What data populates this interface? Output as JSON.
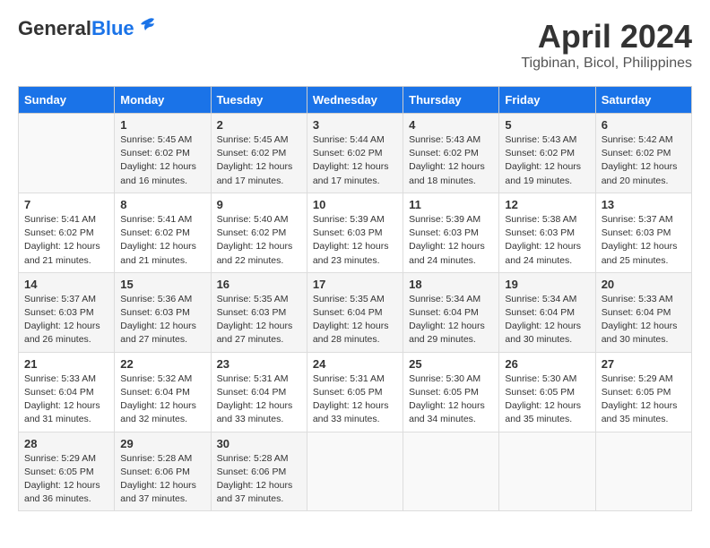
{
  "header": {
    "logo_general": "General",
    "logo_blue": "Blue",
    "month": "April 2024",
    "location": "Tigbinan, Bicol, Philippines"
  },
  "calendar": {
    "days_of_week": [
      "Sunday",
      "Monday",
      "Tuesday",
      "Wednesday",
      "Thursday",
      "Friday",
      "Saturday"
    ],
    "weeks": [
      [
        {
          "day": "",
          "info": ""
        },
        {
          "day": "1",
          "info": "Sunrise: 5:45 AM\nSunset: 6:02 PM\nDaylight: 12 hours\nand 16 minutes."
        },
        {
          "day": "2",
          "info": "Sunrise: 5:45 AM\nSunset: 6:02 PM\nDaylight: 12 hours\nand 17 minutes."
        },
        {
          "day": "3",
          "info": "Sunrise: 5:44 AM\nSunset: 6:02 PM\nDaylight: 12 hours\nand 17 minutes."
        },
        {
          "day": "4",
          "info": "Sunrise: 5:43 AM\nSunset: 6:02 PM\nDaylight: 12 hours\nand 18 minutes."
        },
        {
          "day": "5",
          "info": "Sunrise: 5:43 AM\nSunset: 6:02 PM\nDaylight: 12 hours\nand 19 minutes."
        },
        {
          "day": "6",
          "info": "Sunrise: 5:42 AM\nSunset: 6:02 PM\nDaylight: 12 hours\nand 20 minutes."
        }
      ],
      [
        {
          "day": "7",
          "info": "Sunrise: 5:41 AM\nSunset: 6:02 PM\nDaylight: 12 hours\nand 21 minutes."
        },
        {
          "day": "8",
          "info": "Sunrise: 5:41 AM\nSunset: 6:02 PM\nDaylight: 12 hours\nand 21 minutes."
        },
        {
          "day": "9",
          "info": "Sunrise: 5:40 AM\nSunset: 6:02 PM\nDaylight: 12 hours\nand 22 minutes."
        },
        {
          "day": "10",
          "info": "Sunrise: 5:39 AM\nSunset: 6:03 PM\nDaylight: 12 hours\nand 23 minutes."
        },
        {
          "day": "11",
          "info": "Sunrise: 5:39 AM\nSunset: 6:03 PM\nDaylight: 12 hours\nand 24 minutes."
        },
        {
          "day": "12",
          "info": "Sunrise: 5:38 AM\nSunset: 6:03 PM\nDaylight: 12 hours\nand 24 minutes."
        },
        {
          "day": "13",
          "info": "Sunrise: 5:37 AM\nSunset: 6:03 PM\nDaylight: 12 hours\nand 25 minutes."
        }
      ],
      [
        {
          "day": "14",
          "info": "Sunrise: 5:37 AM\nSunset: 6:03 PM\nDaylight: 12 hours\nand 26 minutes."
        },
        {
          "day": "15",
          "info": "Sunrise: 5:36 AM\nSunset: 6:03 PM\nDaylight: 12 hours\nand 27 minutes."
        },
        {
          "day": "16",
          "info": "Sunrise: 5:35 AM\nSunset: 6:03 PM\nDaylight: 12 hours\nand 27 minutes."
        },
        {
          "day": "17",
          "info": "Sunrise: 5:35 AM\nSunset: 6:04 PM\nDaylight: 12 hours\nand 28 minutes."
        },
        {
          "day": "18",
          "info": "Sunrise: 5:34 AM\nSunset: 6:04 PM\nDaylight: 12 hours\nand 29 minutes."
        },
        {
          "day": "19",
          "info": "Sunrise: 5:34 AM\nSunset: 6:04 PM\nDaylight: 12 hours\nand 30 minutes."
        },
        {
          "day": "20",
          "info": "Sunrise: 5:33 AM\nSunset: 6:04 PM\nDaylight: 12 hours\nand 30 minutes."
        }
      ],
      [
        {
          "day": "21",
          "info": "Sunrise: 5:33 AM\nSunset: 6:04 PM\nDaylight: 12 hours\nand 31 minutes."
        },
        {
          "day": "22",
          "info": "Sunrise: 5:32 AM\nSunset: 6:04 PM\nDaylight: 12 hours\nand 32 minutes."
        },
        {
          "day": "23",
          "info": "Sunrise: 5:31 AM\nSunset: 6:04 PM\nDaylight: 12 hours\nand 33 minutes."
        },
        {
          "day": "24",
          "info": "Sunrise: 5:31 AM\nSunset: 6:05 PM\nDaylight: 12 hours\nand 33 minutes."
        },
        {
          "day": "25",
          "info": "Sunrise: 5:30 AM\nSunset: 6:05 PM\nDaylight: 12 hours\nand 34 minutes."
        },
        {
          "day": "26",
          "info": "Sunrise: 5:30 AM\nSunset: 6:05 PM\nDaylight: 12 hours\nand 35 minutes."
        },
        {
          "day": "27",
          "info": "Sunrise: 5:29 AM\nSunset: 6:05 PM\nDaylight: 12 hours\nand 35 minutes."
        }
      ],
      [
        {
          "day": "28",
          "info": "Sunrise: 5:29 AM\nSunset: 6:05 PM\nDaylight: 12 hours\nand 36 minutes."
        },
        {
          "day": "29",
          "info": "Sunrise: 5:28 AM\nSunset: 6:06 PM\nDaylight: 12 hours\nand 37 minutes."
        },
        {
          "day": "30",
          "info": "Sunrise: 5:28 AM\nSunset: 6:06 PM\nDaylight: 12 hours\nand 37 minutes."
        },
        {
          "day": "",
          "info": ""
        },
        {
          "day": "",
          "info": ""
        },
        {
          "day": "",
          "info": ""
        },
        {
          "day": "",
          "info": ""
        }
      ]
    ]
  }
}
